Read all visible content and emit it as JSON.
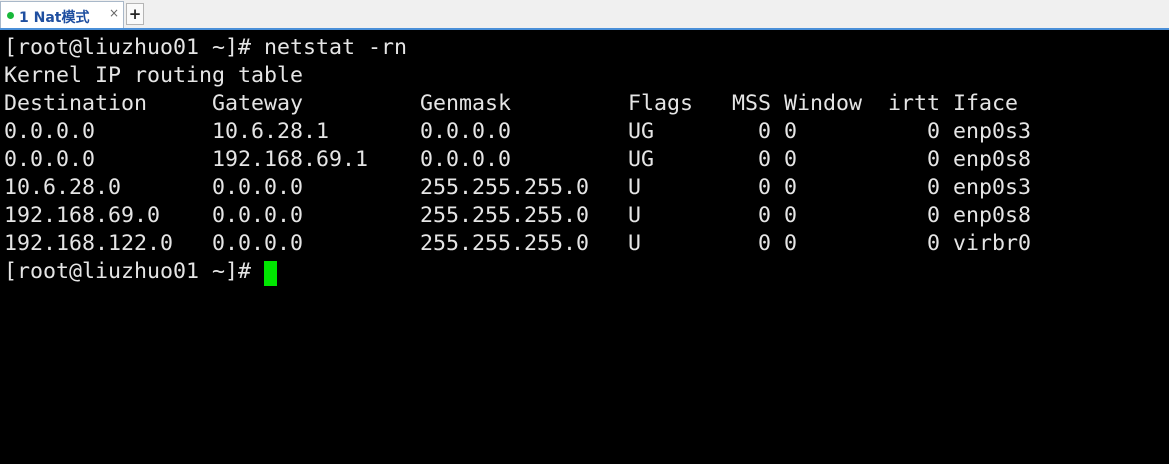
{
  "tab": {
    "status_color": "#18b83a",
    "label": "1 Nat模式",
    "close_glyph": "×",
    "new_tab_glyph": "+"
  },
  "terminal": {
    "lines": [
      "[root@liuzhuo01 ~]# netstat -rn",
      "Kernel IP routing table",
      "Destination     Gateway         Genmask         Flags   MSS Window  irtt Iface",
      "0.0.0.0         10.6.28.1       0.0.0.0         UG        0 0          0 enp0s3",
      "0.0.0.0         192.168.69.1    0.0.0.0         UG        0 0          0 enp0s8",
      "10.6.28.0       0.0.0.0         255.255.255.0   U         0 0          0 enp0s3",
      "192.168.69.0    0.0.0.0         255.255.255.0   U         0 0          0 enp0s8",
      "192.168.122.0   0.0.0.0         255.255.255.0   U         0 0          0 virbr0",
      "[root@liuzhuo01 ~]# "
    ],
    "cursor_color": "#00e600"
  }
}
